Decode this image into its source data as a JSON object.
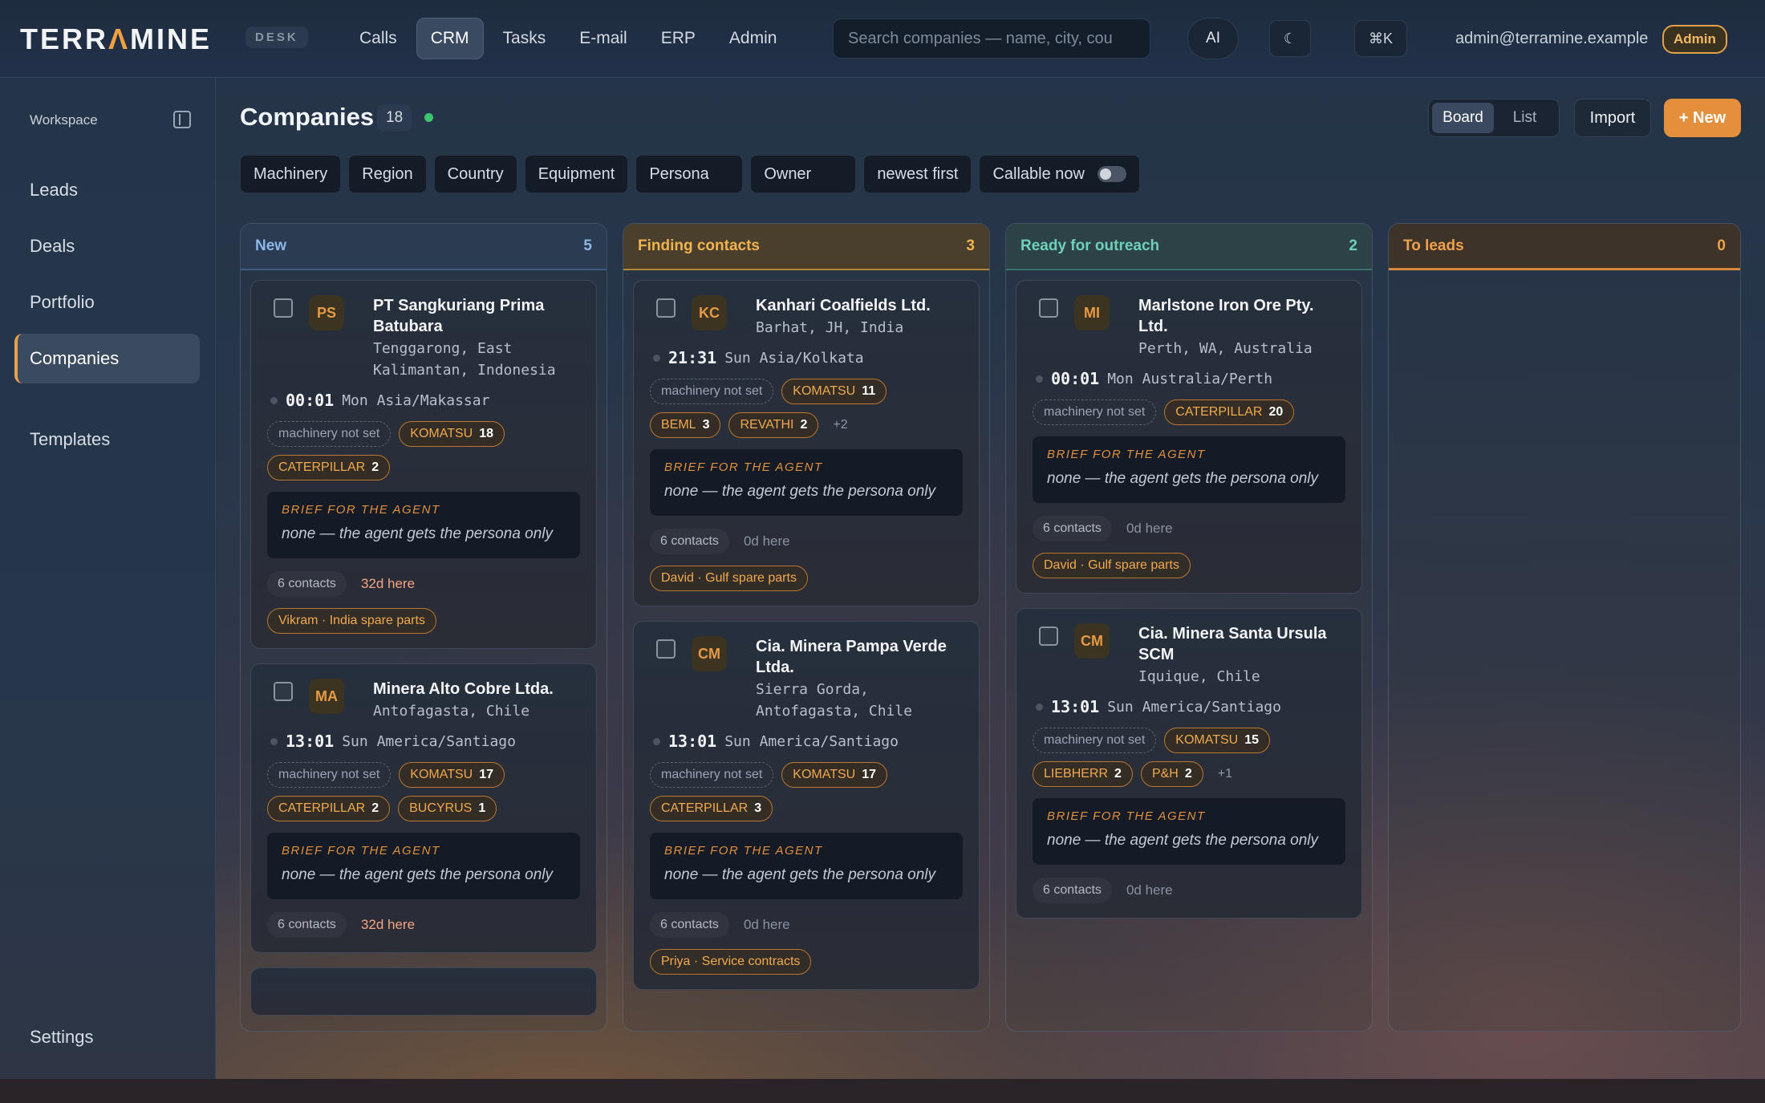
{
  "app": {
    "logo_pre": "TERR",
    "logo_a": "Λ",
    "logo_post": "MINE",
    "badge": "DESK",
    "nav": [
      "Calls",
      "CRM",
      "Tasks",
      "E-mail",
      "ERP",
      "Admin"
    ],
    "nav_active": "CRM",
    "search_placeholder": "Search companies — name, city, cou",
    "ai_label": "AI",
    "theme_icon": "☾",
    "shortcut": "⌘K",
    "user_email": "admin@terramine.example",
    "role": "Admin"
  },
  "sidebar": {
    "workspace": "Workspace",
    "items": [
      "Leads",
      "Deals",
      "Portfolio",
      "Companies",
      "Templates"
    ],
    "active": "Companies",
    "settings": "Settings"
  },
  "header": {
    "title": "Companies",
    "count": "18",
    "view_board": "Board",
    "view_list": "List",
    "import": "Import",
    "new": "+ New"
  },
  "filters": [
    "Machinery",
    "Region",
    "Country",
    "Equipment",
    "Persona",
    "Owner",
    "newest first"
  ],
  "callable_label": "Callable now",
  "columns": [
    {
      "title": "New",
      "count": "5",
      "cards": [
        {
          "initials": "PS",
          "name": "PT Sangkuriang Prima Batubara",
          "location": "Tenggarong, East Kalimantan, Indonesia",
          "time": "00:01",
          "tz": "Mon Asia/Makassar",
          "machinery": "machinery not set",
          "brands": [
            {
              "name": "KOMATSU",
              "n": "18"
            },
            {
              "name": "CATERPILLAR",
              "n": "2"
            }
          ],
          "more": "",
          "brief_label": "BRIEF FOR THE AGENT",
          "brief": "none — the agent gets the persona only",
          "contacts": "6 contacts",
          "here": "32d here",
          "here_hot": true,
          "owner": "Vikram · India spare parts"
        },
        {
          "initials": "MA",
          "name": "Minera Alto Cobre Ltda.",
          "location": "Antofagasta, Chile",
          "time": "13:01",
          "tz": "Sun America/Santiago",
          "machinery": "machinery not set",
          "brands": [
            {
              "name": "KOMATSU",
              "n": "17"
            },
            {
              "name": "CATERPILLAR",
              "n": "2"
            },
            {
              "name": "BUCYRUS",
              "n": "1"
            }
          ],
          "more": "",
          "brief_label": "BRIEF FOR THE AGENT",
          "brief": "none — the agent gets the persona only",
          "contacts": "6 contacts",
          "here": "32d here",
          "here_hot": true,
          "owner": ""
        }
      ]
    },
    {
      "title": "Finding contacts",
      "count": "3",
      "cards": [
        {
          "initials": "KC",
          "name": "Kanhari Coalfields Ltd.",
          "location": "Barhat, JH, India",
          "time": "21:31",
          "tz": "Sun Asia/Kolkata",
          "machinery": "machinery not set",
          "brands": [
            {
              "name": "KOMATSU",
              "n": "11"
            },
            {
              "name": "BEML",
              "n": "3"
            },
            {
              "name": "REVATHI",
              "n": "2"
            }
          ],
          "more": "+2",
          "brief_label": "BRIEF FOR THE AGENT",
          "brief": "none — the agent gets the persona only",
          "contacts": "6 contacts",
          "here": "0d here",
          "here_hot": false,
          "owner": "David · Gulf spare parts"
        },
        {
          "initials": "CM",
          "name": "Cia. Minera Pampa Verde Ltda.",
          "location": "Sierra Gorda, Antofagasta, Chile",
          "time": "13:01",
          "tz": "Sun America/Santiago",
          "machinery": "machinery not set",
          "brands": [
            {
              "name": "KOMATSU",
              "n": "17"
            },
            {
              "name": "CATERPILLAR",
              "n": "3"
            }
          ],
          "more": "",
          "brief_label": "BRIEF FOR THE AGENT",
          "brief": "none — the agent gets the persona only",
          "contacts": "6 contacts",
          "here": "0d here",
          "here_hot": false,
          "owner": "Priya · Service contracts"
        }
      ]
    },
    {
      "title": "Ready for outreach",
      "count": "2",
      "cards": [
        {
          "initials": "MI",
          "name": "Marlstone Iron Ore Pty. Ltd.",
          "location": "Perth, WA, Australia",
          "time": "00:01",
          "tz": "Mon Australia/Perth",
          "machinery": "machinery not set",
          "brands": [
            {
              "name": "CATERPILLAR",
              "n": "20"
            }
          ],
          "more": "",
          "brief_label": "BRIEF FOR THE AGENT",
          "brief": "none — the agent gets the persona only",
          "contacts": "6 contacts",
          "here": "0d here",
          "here_hot": false,
          "owner": "David · Gulf spare parts"
        },
        {
          "initials": "CM",
          "name": "Cia. Minera Santa Ursula SCM",
          "location": "Iquique, Chile",
          "time": "13:01",
          "tz": "Sun America/Santiago",
          "machinery": "machinery not set",
          "brands": [
            {
              "name": "KOMATSU",
              "n": "15"
            },
            {
              "name": "LIEBHERR",
              "n": "2"
            },
            {
              "name": "P&H",
              "n": "2"
            }
          ],
          "more": "+1",
          "brief_label": "BRIEF FOR THE AGENT",
          "brief": "none — the agent gets the persona only",
          "contacts": "6 contacts",
          "here": "0d here",
          "here_hot": false,
          "owner": ""
        }
      ]
    },
    {
      "title": "To leads",
      "count": "0",
      "cards": []
    }
  ]
}
